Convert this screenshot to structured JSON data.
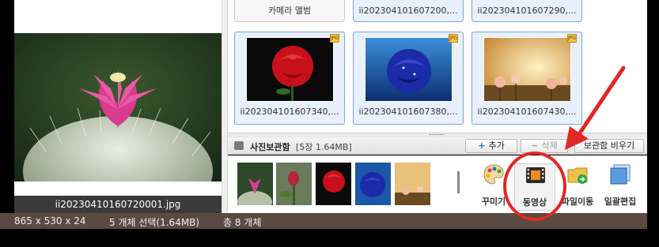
{
  "preview": {
    "caption": "ii20230410160720001.jpg"
  },
  "top_row": [
    {
      "label": "카메라 앨범"
    },
    {
      "label": "ii2023041016072​00,..."
    },
    {
      "label": "ii2023041016072​90,..."
    }
  ],
  "tiles": [
    {
      "name": "ii2023041016073​40,...",
      "badge": "JPG"
    },
    {
      "name": "ii2023041016073​80,...",
      "badge": "JPG"
    },
    {
      "name": "ii2023041016074​30,...",
      "badge": "JPG"
    }
  ],
  "vault": {
    "title": "사진보관함",
    "count": "[5장 1.64MB]",
    "add_label": "추가",
    "delete_label": "삭제",
    "empty_label": "보관함 비우기"
  },
  "tools": [
    {
      "label": "꾸미기",
      "icon": "palette-icon"
    },
    {
      "label": "동영상",
      "icon": "film-icon"
    },
    {
      "label": "파일이동",
      "icon": "folder-move-icon"
    },
    {
      "label": "일괄편집",
      "icon": "batch-edit-icon"
    }
  ],
  "status": {
    "dimensions": "865 x 530 x 24",
    "selection": "5 개체 선택(1.64MB)",
    "total": "총 8 개체"
  },
  "colors": {
    "accent": "#7aa7d8",
    "annotation": "#e32626",
    "status_bg": "#5a4a42"
  }
}
